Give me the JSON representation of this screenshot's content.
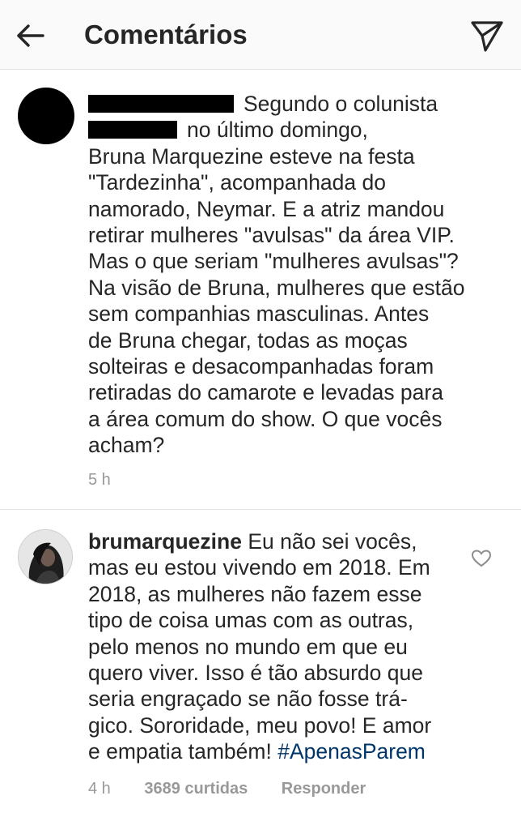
{
  "header": {
    "title": "Comentários",
    "back_icon": "arrow-left-icon",
    "send_icon": "paper-plane-icon"
  },
  "comments": [
    {
      "username": "",
      "lines": [
        "Segundo o colunista",
        "no último domingo,",
        "Bruna Marquezine esteve na festa",
        "\"Tardezinha\", acompanhada do",
        "namorado, Neymar. E a atriz mandou",
        "retirar mulheres \"avulsas\" da área VIP.",
        "Mas o que seriam \"mulheres avulsas\"?",
        "Na visão de Bruna, mulheres que estão",
        "sem companhias masculinas. Antes",
        "de Bruna chegar, todas as moças",
        "solteiras e desacompanhadas foram",
        "retiradas do camarote e levadas para",
        "a área comum do show. O que vocês",
        "acham?"
      ],
      "time": "5 h"
    },
    {
      "username": "brumarquezine",
      "lines": [
        "Eu não sei vocês,",
        "mas eu estou vivendo em 2018. Em",
        "2018, as mulheres não fazem esse",
        "tipo de coisa umas com as outras,",
        "pelo menos no mundo em que eu",
        "quero viver. Isso é tão absurdo que",
        "seria engraçado se não fosse trá-",
        "gico. Sororidade, meu povo! E amor",
        "e empatia também!"
      ],
      "hashtag": "#ApenasParem",
      "time": "4 h",
      "likes": "3689 curtidas",
      "reply": "Responder",
      "like_icon": "heart-outline-icon"
    }
  ],
  "colors": {
    "text": "#262626",
    "meta": "#999999",
    "hashtag": "#003569",
    "header_bg": "#fafafa"
  }
}
